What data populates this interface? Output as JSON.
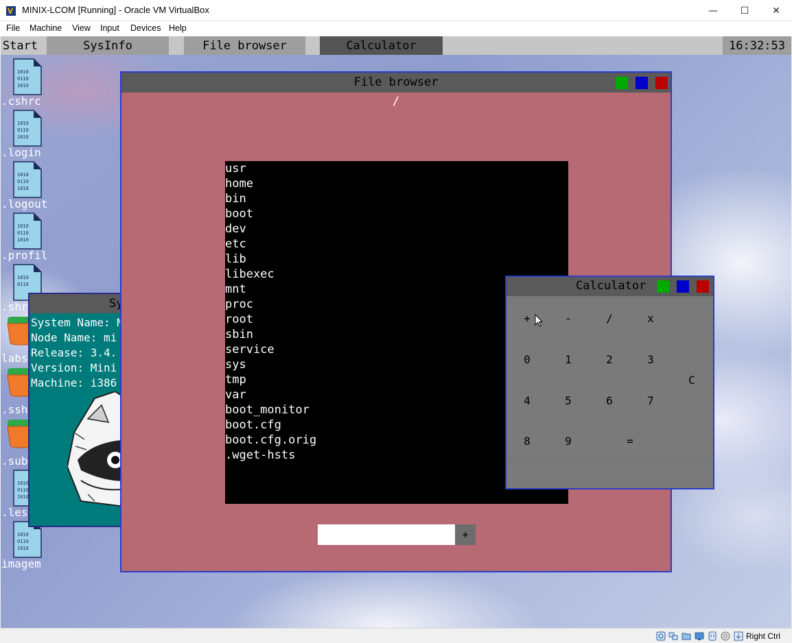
{
  "host": {
    "title": "MINIX-LCOM [Running] - Oracle VM VirtualBox",
    "menu": [
      "File",
      "Machine",
      "View",
      "Input",
      "Devices",
      "Help"
    ],
    "controls": {
      "minimize": "—",
      "maximize": "☐",
      "close": "✕"
    },
    "status": {
      "host_key": "Right Ctrl"
    }
  },
  "taskbar": {
    "start": "Start",
    "buttons": [
      "SysInfo",
      "File browser",
      "Calculator"
    ],
    "clock": "16:32:53"
  },
  "desktop_icons": [
    {
      "label": ".cshrc",
      "type": "file"
    },
    {
      "label": ".login",
      "type": "file"
    },
    {
      "label": ".logout",
      "type": "file"
    },
    {
      "label": ".profil",
      "type": "file"
    },
    {
      "label": ".shr",
      "type": "file"
    },
    {
      "label": "labs",
      "type": "folder"
    },
    {
      "label": ".ssh",
      "type": "folder"
    },
    {
      "label": ".sub",
      "type": "folder"
    },
    {
      "label": ".les",
      "type": "file"
    },
    {
      "label": "imagem",
      "type": "file"
    }
  ],
  "sysinfo": {
    "title": "Sy",
    "lines": [
      "System Name: M",
      "Node Name: mi",
      "Release: 3.4.",
      "Version: Mini",
      "Machine: i386"
    ]
  },
  "file_browser": {
    "title": "File browser",
    "path": "/",
    "entries": [
      "usr",
      "home",
      "bin",
      "boot",
      "dev",
      "etc",
      "lib",
      "libexec",
      "mnt",
      "proc",
      "root",
      "sbin",
      "service",
      "sys",
      "tmp",
      "var",
      "boot_monitor",
      "boot.cfg",
      "boot.cfg.orig",
      ".wget-hsts"
    ],
    "input_value": "",
    "add_label": "+"
  },
  "calculator": {
    "title": "Calculator",
    "ops": [
      "+",
      "-",
      "/",
      "x"
    ],
    "row1": [
      "0",
      "1",
      "2",
      "3"
    ],
    "row2": [
      "4",
      "5",
      "6",
      "7"
    ],
    "row3": [
      "8",
      "9"
    ],
    "equals": "=",
    "clear": "C",
    "display": ""
  },
  "window_button_colors": {
    "green": "#00aa00",
    "blue": "#0000cc",
    "red": "#bb0000"
  }
}
